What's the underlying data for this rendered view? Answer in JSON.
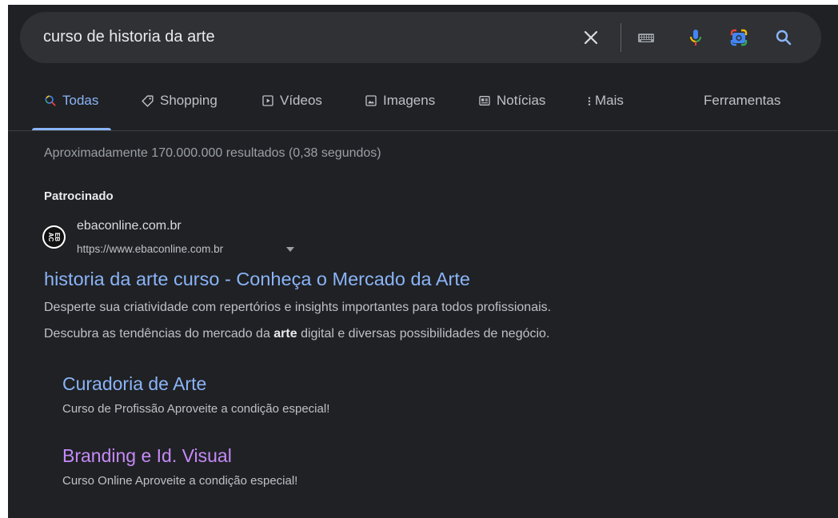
{
  "search": {
    "query": "curso de historia da arte",
    "icons": [
      "close-icon",
      "keyboard-icon",
      "mic-icon",
      "google-lens-icon",
      "search-icon"
    ]
  },
  "tabs": [
    {
      "label": "Todas",
      "icon": "search-icon",
      "active": true
    },
    {
      "label": "Shopping",
      "icon": "tag-icon"
    },
    {
      "label": "Vídeos",
      "icon": "play-icon"
    },
    {
      "label": "Imagens",
      "icon": "image-icon"
    },
    {
      "label": "Notícias",
      "icon": "newspaper-icon"
    },
    {
      "label": "Mais",
      "icon": "more-vert-icon"
    }
  ],
  "tools_label": "Ferramentas",
  "result_stats": "Aproximadamente 170.000.000 resultados (0,38 segundos)",
  "ad": {
    "sponsored_label": "Patrocinado",
    "site_name": "ebaconline.com.br",
    "url": "https://www.ebaconline.com.br",
    "favicon_text": "EBAC",
    "title": "historia da arte curso - Conheça o Mercado da Arte",
    "desc_line1": "Desperte sua criatividade com repertórios e insights importantes para todos profissionais.",
    "desc_line2_before": "Descubra as tendências do mercado da ",
    "desc_line2_bold": "arte",
    "desc_line2_after": " digital e diversas possibilidades de negócio.",
    "sitelinks": [
      {
        "title": "Curadoria de Arte",
        "desc": "Curso de Profissão Aproveite a condição especial!"
      },
      {
        "title": "Branding e Id. Visual",
        "desc": "Curso Online Aproveite a condição especial!"
      }
    ]
  },
  "colors": {
    "background": "#202124",
    "searchbar": "#303134",
    "link": "#8ab4f8",
    "visited_link": "#c58af9",
    "text": "#bdc1c6"
  }
}
